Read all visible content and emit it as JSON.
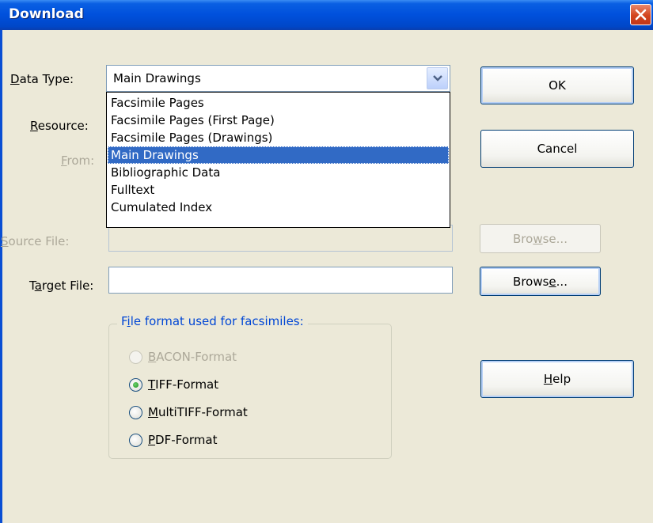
{
  "window": {
    "title": "Download"
  },
  "labels": {
    "data_type": "Data Type:",
    "resource": "Resource:",
    "from": "From:",
    "source_file": "Source File:",
    "target_file": "Target File:"
  },
  "data_type_combo": {
    "value": "Main Drawings",
    "options": [
      "Facsimile Pages",
      "Facsimile Pages (First Page)",
      "Facsimile Pages (Drawings)",
      "Main Drawings",
      "Bibliographic Data",
      "Fulltext",
      "Cumulated Index"
    ],
    "selected_index": 3
  },
  "source_file": {
    "value": ""
  },
  "target_file": {
    "value": ""
  },
  "buttons": {
    "ok": "OK",
    "cancel": "Cancel",
    "browse_source": "Browse...",
    "browse_target": "Browse...",
    "help": "Help"
  },
  "file_format": {
    "legend": "File format used for facsimiles:",
    "options": [
      {
        "label": "BACON-Format",
        "checked": false,
        "enabled": false
      },
      {
        "label": "TIFF-Format",
        "checked": true,
        "enabled": true
      },
      {
        "label": "MultiTIFF-Format",
        "checked": false,
        "enabled": true
      },
      {
        "label": "PDF-Format",
        "checked": false,
        "enabled": true
      }
    ]
  },
  "colors": {
    "titlebar": "#0050dc",
    "selection": "#316ac5",
    "dialog_bg": "#ece9d8",
    "group_legend": "#0046d5"
  }
}
